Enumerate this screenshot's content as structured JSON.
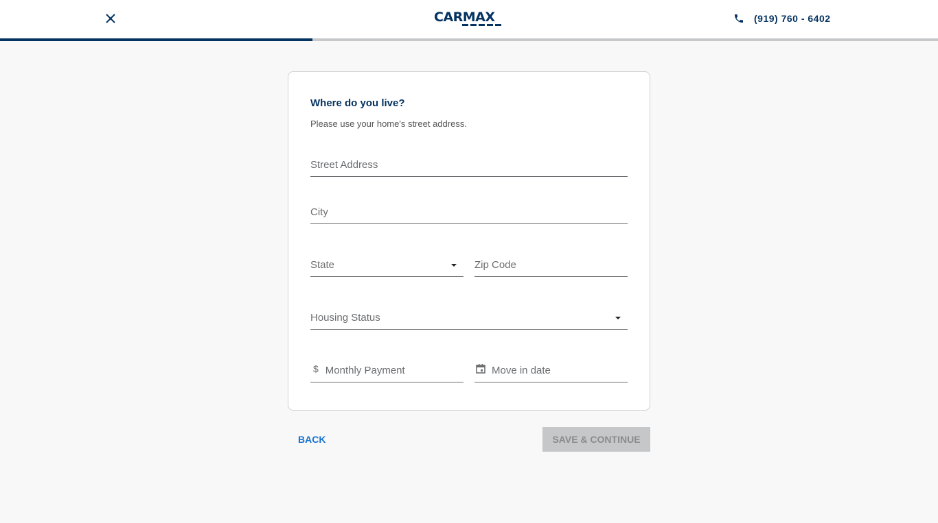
{
  "header": {
    "phone": "(919) 760 - 6402",
    "logo_text": "CARMAX"
  },
  "progress": {
    "percent": 33.3
  },
  "form": {
    "title": "Where do you live?",
    "subtitle": "Please use your home's street address.",
    "street": "Street Address",
    "city": "City",
    "state": "State",
    "zip": "Zip Code",
    "housing": "Housing Status",
    "payment": "Monthly Payment",
    "payment_prefix": "$",
    "move_in": "Move in date"
  },
  "actions": {
    "back": "BACK",
    "save": "SAVE & CONTINUE"
  },
  "colors": {
    "brand": "#053361",
    "link": "#1773cf"
  }
}
